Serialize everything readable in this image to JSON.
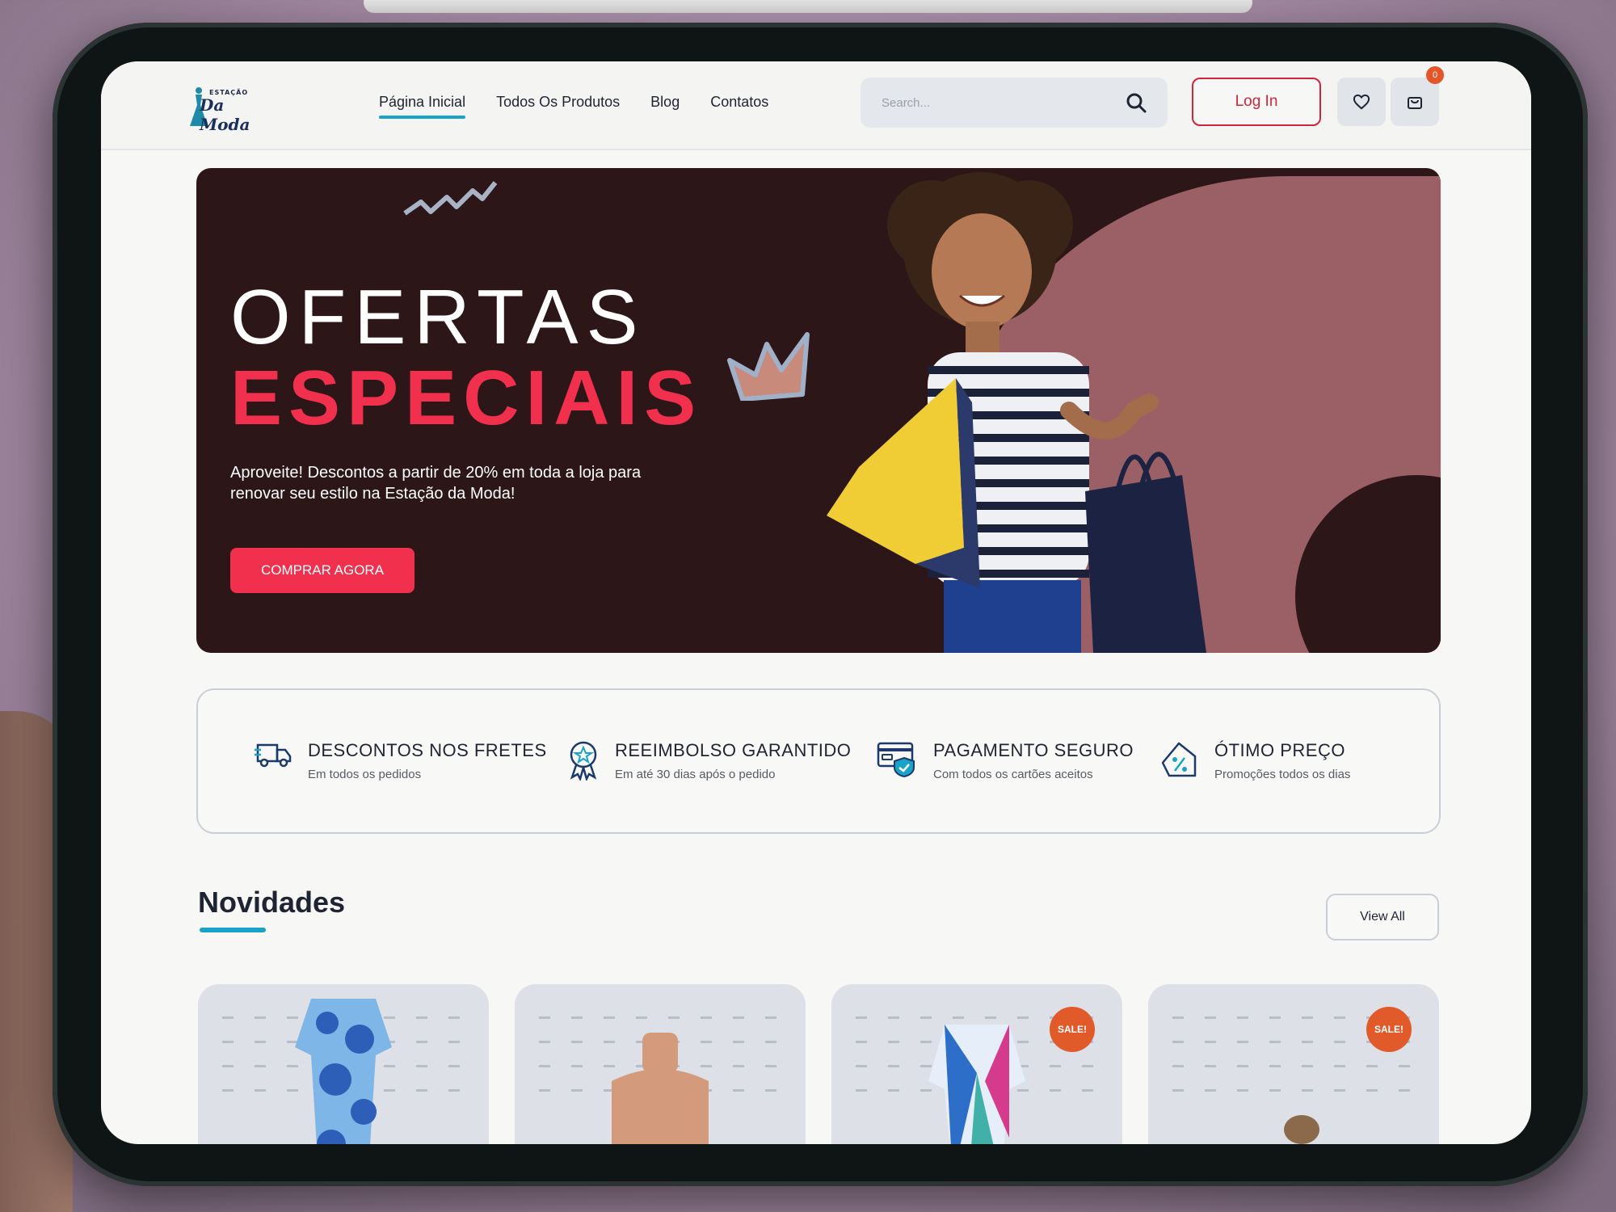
{
  "brand": {
    "small": "ESTAÇÃO",
    "name": "Da Moda"
  },
  "nav": {
    "items": [
      {
        "label": "Página Inicial",
        "active": true
      },
      {
        "label": "Todos Os Produtos",
        "active": false
      },
      {
        "label": "Blog",
        "active": false
      },
      {
        "label": "Contatos",
        "active": false
      }
    ]
  },
  "search": {
    "placeholder": "Search..."
  },
  "header": {
    "login_label": "Log In",
    "cart_count": "0"
  },
  "hero": {
    "title_line1": "OFERTAS",
    "title_line2": "ESPECIAIS",
    "subtitle": "Aproveite! Descontos a partir de 20% em toda a loja para renovar seu estilo na Estação da Moda!",
    "cta_label": "COMPRAR AGORA"
  },
  "features": [
    {
      "icon": "truck-icon",
      "title": "DESCONTOS NOS FRETES",
      "desc": "Em todos os pedidos"
    },
    {
      "icon": "award-icon",
      "title": "REEIMBOLSO GARANTIDO",
      "desc": "Em até 30 dias após o pedido"
    },
    {
      "icon": "secure-card-icon",
      "title": "PAGAMENTO SEGURO",
      "desc": "Com todos os cartões aceitos"
    },
    {
      "icon": "discount-tag-icon",
      "title": "ÓTIMO PREÇO",
      "desc": "Promoções todos os dias"
    }
  ],
  "novidades": {
    "title": "Novidades",
    "view_all_label": "View All",
    "products": [
      {
        "sale": false,
        "badge": ""
      },
      {
        "sale": false,
        "badge": ""
      },
      {
        "sale": true,
        "badge": "SALE!"
      },
      {
        "sale": true,
        "badge": "SALE!"
      }
    ]
  },
  "colors": {
    "accent_blue": "#1aa3c9",
    "accent_red": "#f0304d",
    "hero_bg": "#2c1618",
    "sale_orange": "#e05a2a"
  }
}
